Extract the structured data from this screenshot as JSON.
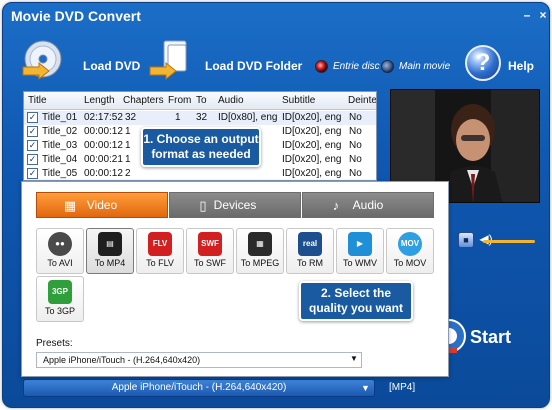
{
  "window": {
    "title": "Movie DVD Convert"
  },
  "toolbar": {
    "load_dvd": "Load DVD",
    "load_dvd_folder": "Load DVD Folder",
    "entire_disc": "Entrie disc",
    "main_movie": "Main movie",
    "help": "Help"
  },
  "table": {
    "headers": [
      "Title",
      "Length",
      "Chapters",
      "From",
      "To",
      "Audio",
      "Subtitle",
      "Deinterl"
    ],
    "rows": [
      {
        "title": "Title_01",
        "length": "02:17:52",
        "chapters": "32",
        "from": "1",
        "to": "32",
        "audio": "ID[0x80], eng",
        "subtitle": "ID[0x20], eng",
        "deinterlace": "No",
        "checked": true
      },
      {
        "title": "Title_02",
        "length": "00:00:12",
        "chapters": "1",
        "from": "",
        "to": "",
        "audio": "",
        "subtitle": "ID[0x20], eng",
        "deinterlace": "No",
        "checked": true
      },
      {
        "title": "Title_03",
        "length": "00:00:12",
        "chapters": "1",
        "from": "",
        "to": "",
        "audio": "",
        "subtitle": "ID[0x20], eng",
        "deinterlace": "No",
        "checked": true
      },
      {
        "title": "Title_04",
        "length": "00:00:21",
        "chapters": "1",
        "from": "",
        "to": "",
        "audio": "",
        "subtitle": "ID[0x20], eng",
        "deinterlace": "No",
        "checked": true
      },
      {
        "title": "Title_05",
        "length": "00:00:12",
        "chapters": "2",
        "from": "",
        "to": "",
        "audio": "",
        "subtitle": "ID[0x20], eng",
        "deinterlace": "No",
        "checked": true
      }
    ]
  },
  "popup": {
    "tabs": {
      "video": "Video",
      "devices": "Devices",
      "audio": "Audio"
    },
    "formats": [
      {
        "label": "To AVI",
        "icon": "film-reel-icon",
        "color": "#4a4a4a"
      },
      {
        "label": "To MP4",
        "icon": "clapperboard-icon",
        "color": "#1f1f1f"
      },
      {
        "label": "To FLV",
        "icon": "flv-icon",
        "color": "#d21f1f"
      },
      {
        "label": "To SWF",
        "icon": "swf-icon",
        "color": "#d21f1f"
      },
      {
        "label": "To MPEG",
        "icon": "clapper-icon",
        "color": "#2b2b2b"
      },
      {
        "label": "To RM",
        "icon": "real-icon",
        "color": "#1d4f8e"
      },
      {
        "label": "To WMV",
        "icon": "wmv-icon",
        "color": "#1f8fd8"
      },
      {
        "label": "To MOV",
        "icon": "mov-icon",
        "color": "#2e9fe3"
      },
      {
        "label": "To 3GP",
        "icon": "phone-icon",
        "color": "#2f9f3b"
      }
    ],
    "presets_label": "Presets:",
    "presets_value": "Apple iPhone/iTouch - (H.264,640x420)"
  },
  "callouts": {
    "one": "1. Choose an output format as needed",
    "two": "2. Select the quality you want"
  },
  "bottom": {
    "profile": "Apple iPhone/iTouch - (H.264,640x420)",
    "tag": "[MP4]"
  },
  "start": "Start",
  "colors": {
    "accent": "#e2670f",
    "window_blue": "#0f57b0",
    "callout_blue": "#1a5aa0"
  }
}
